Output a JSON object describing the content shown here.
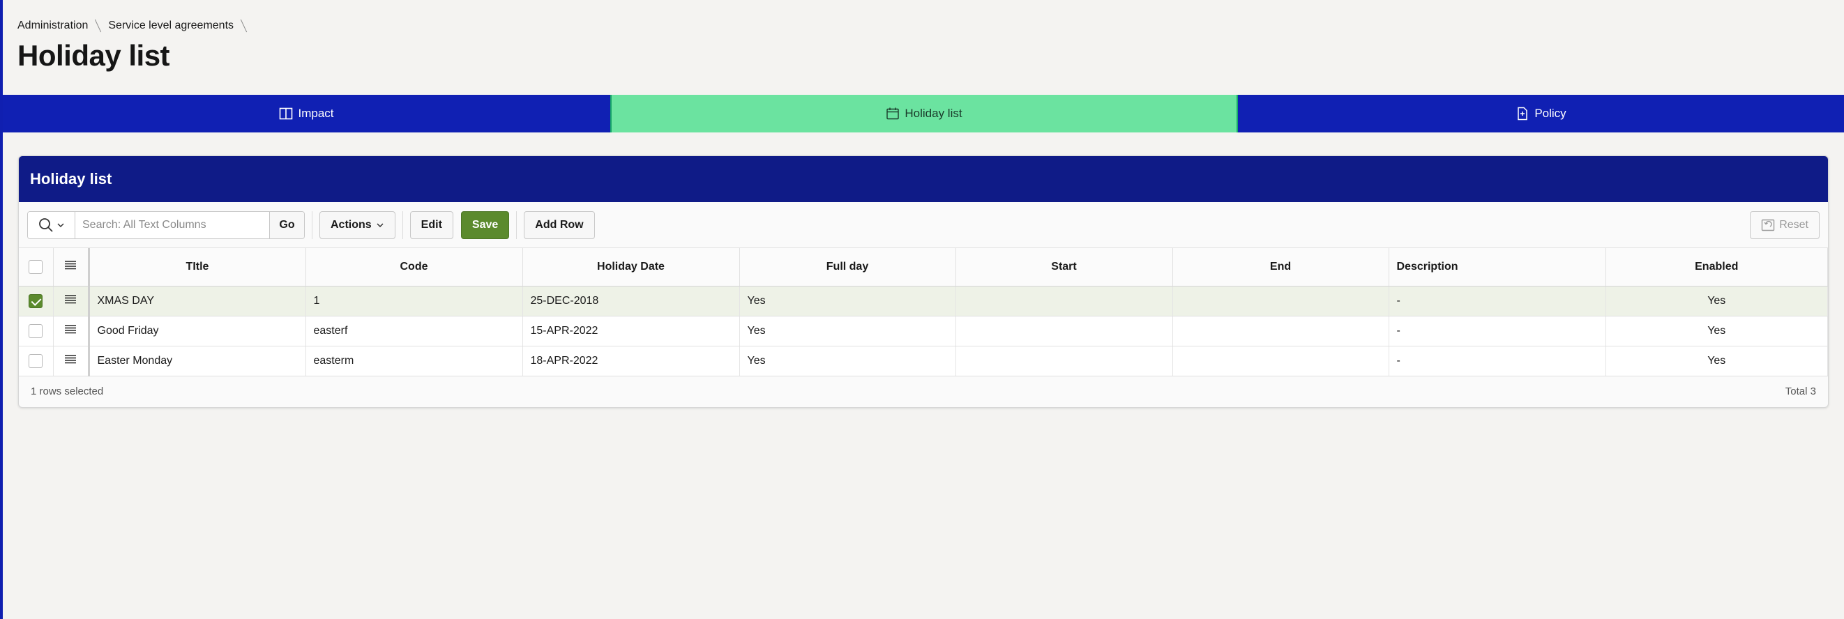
{
  "breadcrumb": {
    "items": [
      "Administration",
      "Service level agreements"
    ]
  },
  "page": {
    "title": "Holiday list"
  },
  "tabs": [
    {
      "label": "Impact",
      "icon": "columns-icon"
    },
    {
      "label": "Holiday list",
      "icon": "calendar-icon",
      "active": true
    },
    {
      "label": "Policy",
      "icon": "document-icon"
    }
  ],
  "region": {
    "title": "Holiday list",
    "search": {
      "placeholder": "Search: All Text Columns",
      "value": ""
    },
    "toolbar": {
      "go_label": "Go",
      "actions_label": "Actions",
      "edit_label": "Edit",
      "save_label": "Save",
      "add_row_label": "Add Row",
      "reset_label": "Reset"
    },
    "columns": [
      "TItle",
      "Code",
      "Holiday Date",
      "Full day",
      "Start",
      "End",
      "Description",
      "Enabled"
    ],
    "rows": [
      {
        "selected": true,
        "title": "XMAS DAY",
        "code": "1",
        "date": "25-DEC-2018",
        "full_day": "Yes",
        "start": "",
        "end": "",
        "description": "-",
        "enabled": "Yes"
      },
      {
        "selected": false,
        "title": "Good Friday",
        "code": "easterf",
        "date": "15-APR-2022",
        "full_day": "Yes",
        "start": "",
        "end": "",
        "description": "-",
        "enabled": "Yes"
      },
      {
        "selected": false,
        "title": "Easter Monday",
        "code": "easterm",
        "date": "18-APR-2022",
        "full_day": "Yes",
        "start": "",
        "end": "",
        "description": "-",
        "enabled": "Yes"
      }
    ],
    "footer": {
      "selection_text": "1 rows selected",
      "total_text": "Total 3"
    }
  },
  "colors": {
    "tab_bar": "#1020b3",
    "tab_active": "#6be3a0",
    "region_header": "#0f1b87",
    "save_button": "#5b8a2d"
  }
}
